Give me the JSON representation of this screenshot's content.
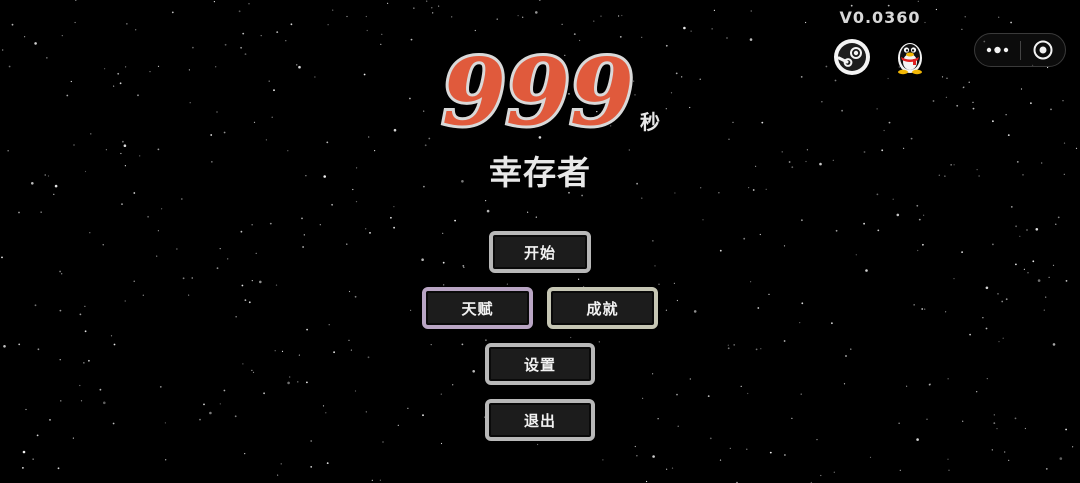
{
  "version": "V0.0360",
  "logo": {
    "number": "999",
    "unit": "秒",
    "number_color": "#e05a3c",
    "outline_color": "#d9d9d9"
  },
  "title": "幸存者",
  "top_icons": [
    {
      "name": "steam-icon"
    },
    {
      "name": "qq-penguin-icon"
    }
  ],
  "capsule": {
    "menu_icon": "more-dots-icon",
    "close_icon": "target-circle-icon"
  },
  "menu": {
    "start_label": "开始",
    "talent_label": "天赋",
    "achievement_label": "成就",
    "settings_label": "设置",
    "exit_label": "退出"
  },
  "colors": {
    "background": "#000000",
    "button_border": "#b8b8b8",
    "talent_border": "#b9a5c4",
    "achievement_border": "#c6c6b4",
    "button_fill": "#1c1c1c"
  }
}
